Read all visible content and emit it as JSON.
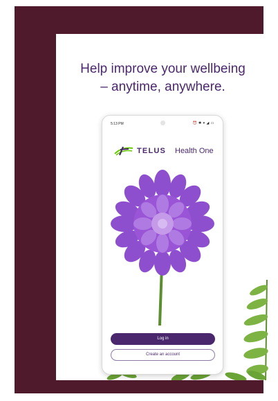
{
  "headline": {
    "line1": "Help improve your wellbeing",
    "line2": "– anytime, anywhere."
  },
  "phone": {
    "status_time": "5:13 PM",
    "status_icons": "⏰ ✱ ▾ ◢ ▭",
    "brand_name": "TELUS",
    "brand_sub": "Health One",
    "login_label": "Log in",
    "create_label": "Create an account"
  },
  "colors": {
    "frame": "#4e1a2c",
    "brand_purple": "#4b286d",
    "brand_green": "#66cc00",
    "flower": "#9a55d6"
  },
  "icons": [
    "telus-logo-icon",
    "dahlia-flower-image",
    "fern-leaf-image"
  ]
}
